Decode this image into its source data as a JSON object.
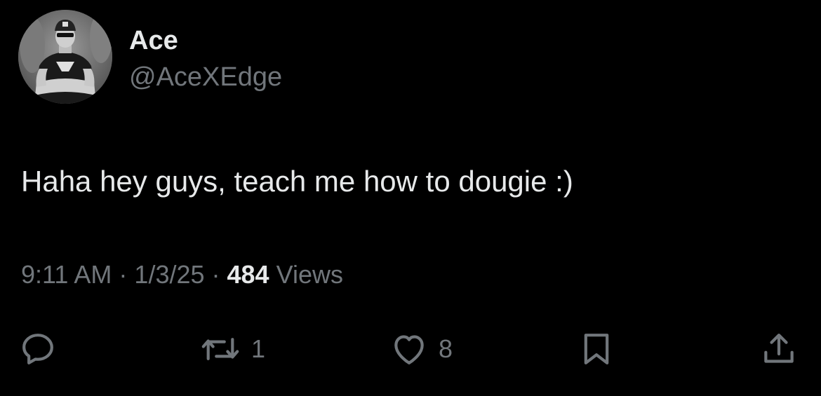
{
  "author": {
    "display_name": "Ace",
    "handle": "@AceXEdge",
    "avatar_icon": "user-photo"
  },
  "tweet": {
    "text": "Haha hey guys, teach me how to dougie :)",
    "time": "9:11 AM",
    "sep1": " · ",
    "date": "1/3/25",
    "sep2": " · ",
    "views_count": "484",
    "views_label": " Views"
  },
  "actions": {
    "reply_icon": "reply-icon",
    "retweet_icon": "retweet-icon",
    "retweet_count": "1",
    "like_icon": "heart-icon",
    "like_count": "8",
    "bookmark_icon": "bookmark-icon",
    "share_icon": "share-icon"
  },
  "colors": {
    "background": "#000000",
    "primary_text": "#e7e9ea",
    "secondary_text": "#71767b"
  }
}
